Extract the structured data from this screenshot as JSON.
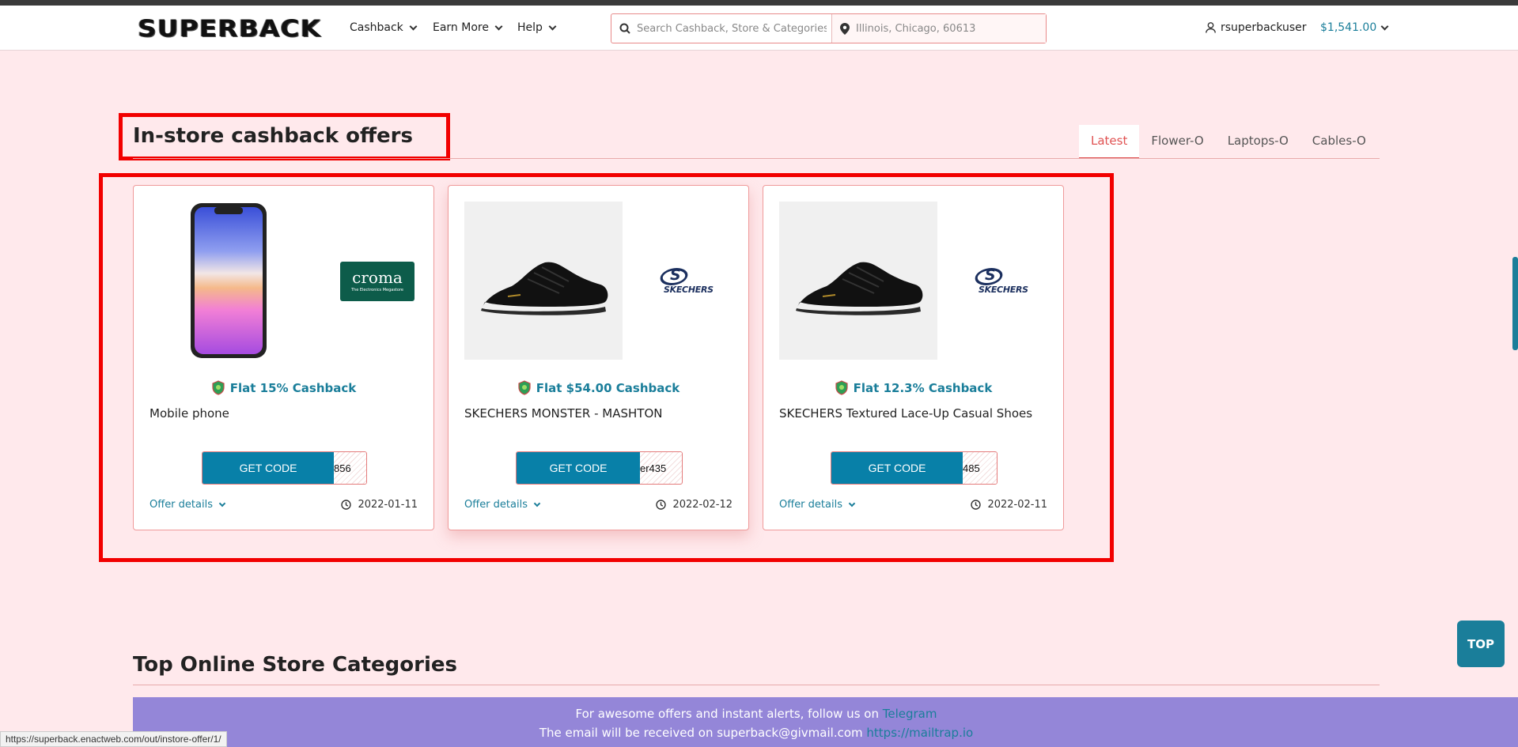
{
  "header": {
    "logo": "SUPERBACK",
    "nav": [
      {
        "label": "Cashback"
      },
      {
        "label": "Earn More"
      },
      {
        "label": "Help"
      }
    ],
    "search_placeholder": "Search Cashback, Store & Categories",
    "location_placeholder": "Illinois, Chicago, 60613",
    "username": "rsuperbackuser",
    "balance": "$1,541.00"
  },
  "instore": {
    "title": "In-store cashback offers",
    "tabs": [
      "Latest",
      "Flower-O",
      "Laptops-O",
      "Cables-O"
    ],
    "active_tab": "Latest",
    "offers": [
      {
        "cashback": "Flat 15% Cashback",
        "title": "Mobile phone",
        "button": "GET CODE",
        "code": "856",
        "offer_details": "Offer details",
        "date": "2022-01-11",
        "brand": "croma",
        "brand_tagline": "The Electronics Megastore"
      },
      {
        "cashback": "Flat $54.00 Cashback",
        "title": "SKECHERS MONSTER - MASHTON",
        "button": "GET CODE",
        "code": "er435",
        "offer_details": "Offer details",
        "date": "2022-02-12",
        "brand": "SKECHERS"
      },
      {
        "cashback": "Flat 12.3% Cashback",
        "title": "SKECHERS Textured Lace-Up Casual Shoes",
        "button": "GET CODE",
        "code": "485",
        "offer_details": "Offer details",
        "date": "2022-02-11",
        "brand": "SKECHERS"
      }
    ]
  },
  "categories": {
    "title": "Top Online Store Categories"
  },
  "footer": {
    "line1_prefix": "For awesome offers and instant alerts, follow us on",
    "line1_link": "Telegram",
    "line2_prefix": "The email will be received on superback@givmail.com",
    "line2_link": "https://mailtrap.io"
  },
  "status_url": "https://superback.enactweb.com/out/instore-offer/1/",
  "top_button": "TOP",
  "colors": {
    "accent": "#1a7e9a",
    "highlight": "#f20000",
    "footer_bg": "#9486d8",
    "page_bg": "#ffe9ec"
  }
}
